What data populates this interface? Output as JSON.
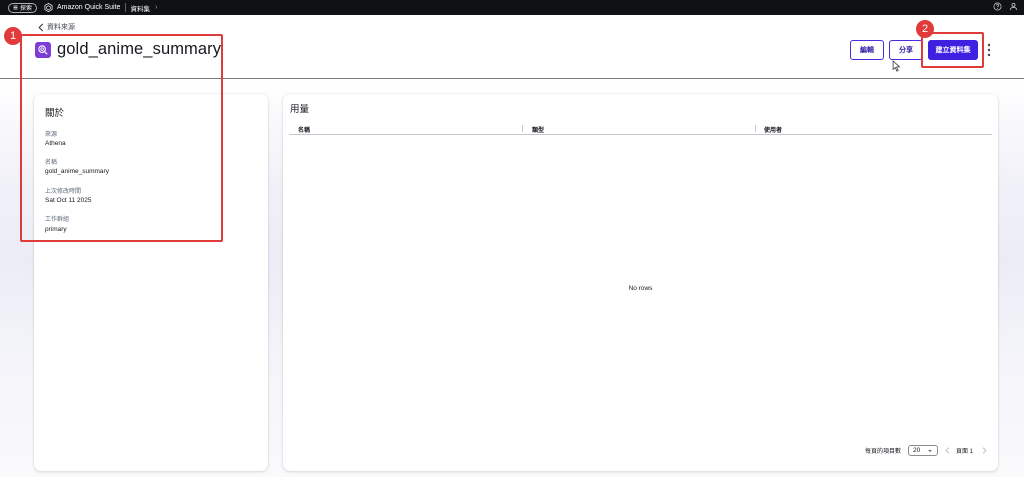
{
  "topbar": {
    "explore_label": "探索",
    "app_name": "Amazon Quick Suite",
    "breadcrumb": "資料集"
  },
  "header": {
    "back_label": "資料來源",
    "title": "gold_anime_summary",
    "edit_label": "編輯",
    "share_label": "分享",
    "create_label": "建立資料集"
  },
  "about": {
    "title": "關於",
    "fields": [
      {
        "label": "來源",
        "value": "Athena"
      },
      {
        "label": "名稱",
        "value": "gold_anime_summary"
      },
      {
        "label": "上次修改時間",
        "value": "Sat Oct 11 2025"
      },
      {
        "label": "工作群組",
        "value": "primary"
      }
    ]
  },
  "usage": {
    "title": "用量",
    "columns": [
      "名稱",
      "類型",
      "使用者"
    ],
    "empty_text": "No rows",
    "per_page_label": "每頁的項目數",
    "per_page_value": "20",
    "page_label": "頁面 1"
  },
  "annotations": [
    "1",
    "2"
  ],
  "colors": {
    "primary": "#3f1fe0",
    "annotation": "#e03a3a",
    "dataset_icon": "#7d3ed7",
    "topbar": "#0f1114"
  }
}
